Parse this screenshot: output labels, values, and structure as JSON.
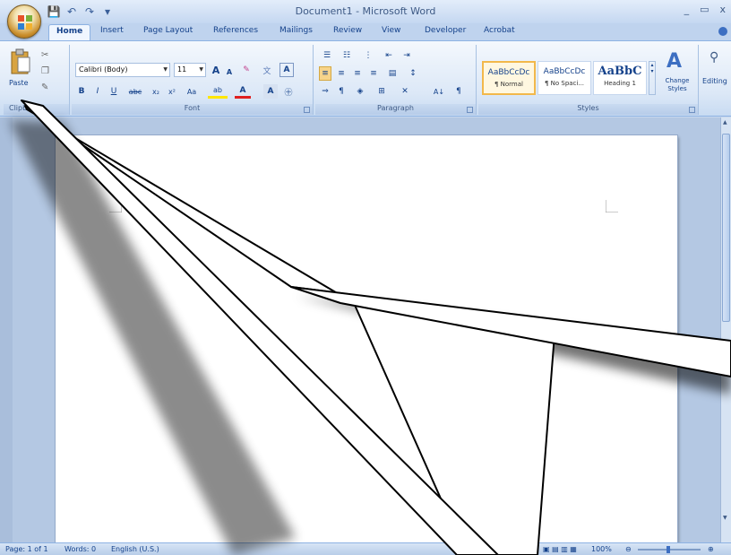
{
  "titlebar": {
    "title": "Document1 - Microsoft Word",
    "minimize": "_",
    "restore": "▭",
    "close": "x",
    "quick_access": [
      {
        "icon": "save-icon",
        "glyph": "💾"
      },
      {
        "icon": "undo-icon",
        "glyph": "↶"
      },
      {
        "icon": "redo-icon",
        "glyph": "↷"
      },
      {
        "icon": "customize-icon",
        "glyph": "▾"
      }
    ]
  },
  "tabs": [
    "Home",
    "Insert",
    "Page Layout",
    "References",
    "Mailings",
    "Review",
    "View",
    "Developer",
    "Acrobat"
  ],
  "ribbon": {
    "clipboard": {
      "label": "Clipboa...",
      "paste": "Paste"
    },
    "font": {
      "label": "Font",
      "font_name": "Calibri (Body)",
      "font_size": "11",
      "grow": "A",
      "shrink": "A",
      "clear": "✎",
      "bold": "B",
      "italic": "I",
      "underline": "U",
      "strike": "abc",
      "subscript": "x₂",
      "superscript": "x²",
      "change_case": "Aa",
      "highlight": "ab",
      "font_color": "A"
    },
    "paragraph": {
      "label": "Paragraph",
      "sort": "A↓",
      "pilcrow": "¶"
    },
    "styles": {
      "label": "Styles",
      "items": [
        {
          "sample": "AaBbCcDc",
          "name": "¶ Normal"
        },
        {
          "sample": "AaBbCcDc",
          "name": "¶ No Spaci..."
        },
        {
          "sample": "AaBbC",
          "name": "Heading 1"
        }
      ],
      "change_styles": "Change Styles",
      "change_styles_line2": "Styles ▾"
    },
    "editing": {
      "label": "Editing"
    }
  },
  "statusbar": {
    "page": "Page: 1 of 1",
    "words": "Words: 0",
    "language": "English (U.S.)",
    "zoom": "100%"
  },
  "colors": {
    "accent": "#15428b",
    "ribbon_bg": "#dce8f7",
    "selected_style": "#f2b84b"
  }
}
